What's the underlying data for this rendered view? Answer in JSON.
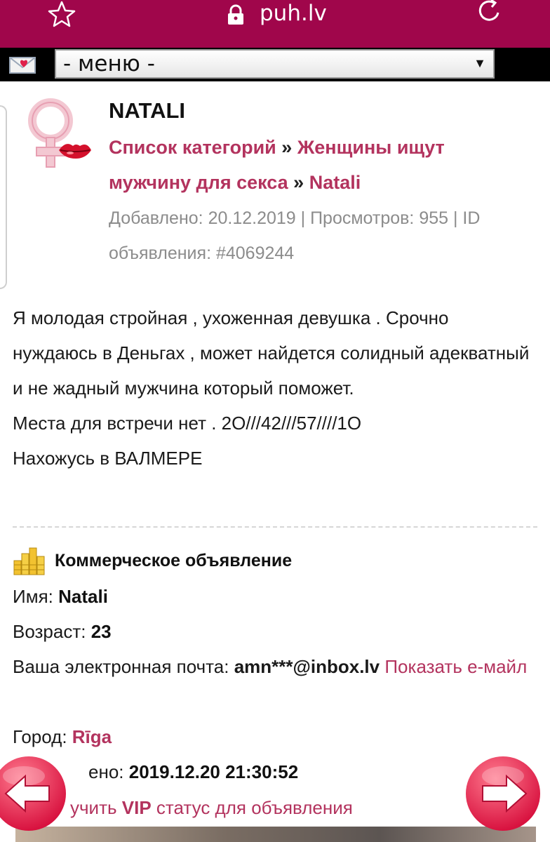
{
  "browser": {
    "url": "puh.lv",
    "star_icon": "star-outline-icon",
    "lock_icon": "lock-icon",
    "reload_icon": "reload-icon",
    "bar_color": "#a0064b"
  },
  "menu": {
    "mail_icon": "mail-heart-icon",
    "select_value": "- меню -"
  },
  "listing": {
    "title": "NATALI",
    "breadcrumb": {
      "root": "Список категорий",
      "separator": "»",
      "category": "Женщины ищут мужчину для секса",
      "current": "Natali"
    },
    "meta": "Добавлено: 20.12.2019 | Просмотров: 955 | ID объявления: #4069244",
    "description": [
      "Я молодая стройная , ухоженная девушка . Срочно нуждаюсь в Деньгах , может найдется солидный адекватный и не жадный мужчина который поможет.",
      "Места для встречи нет . 2О///42///57////1О",
      "Нахожусь в ВАЛМЕРЕ"
    ],
    "commercial_label": "Коммерческое объявление",
    "fields": {
      "name_label": "Имя:",
      "name_value": "Natali",
      "age_label": "Возраст:",
      "age_value": "23",
      "email_label": "Ваша электронная почта:",
      "email_value": "amn***@inbox.lv",
      "show_email": "Показать е-майл",
      "city_label": "Город:",
      "city_value": "Rīga",
      "added_label": "ено:",
      "added_value": "2019.12.20 21:30:52",
      "vip_prefix": "учить",
      "vip_bold": "VIP",
      "vip_suffix": "статус для объявления"
    }
  },
  "nav": {
    "prev_icon": "arrow-left-icon",
    "next_icon": "arrow-right-icon",
    "accent": "#e0204a"
  }
}
